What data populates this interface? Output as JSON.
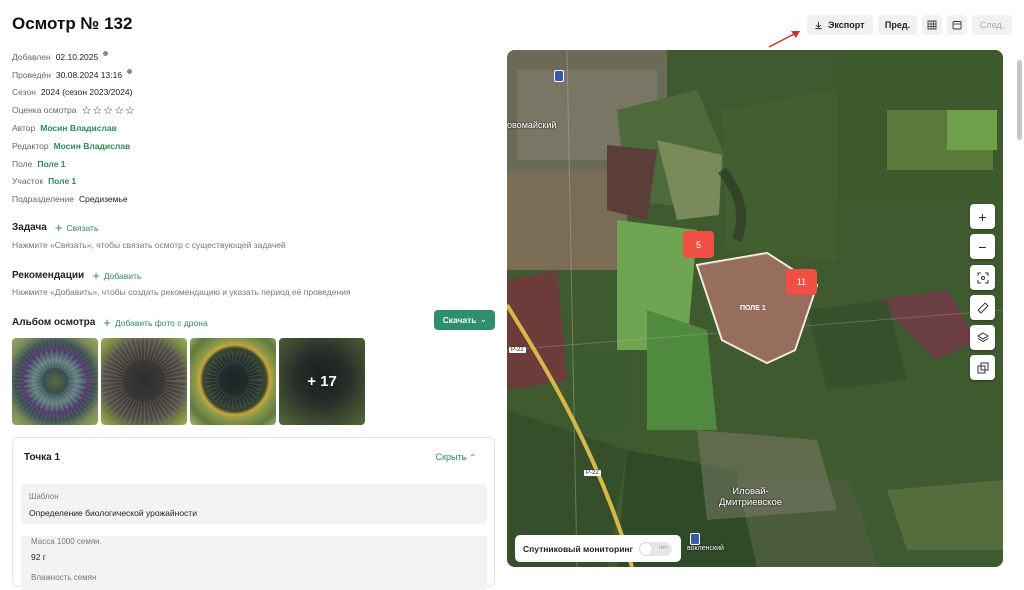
{
  "page": {
    "title": "Осмотр № 132"
  },
  "toolbar": {
    "export": "Экспорт",
    "prev": "Пред.",
    "next": "След."
  },
  "meta": {
    "added_label": "Добавлен",
    "added_value": "02.10.2025",
    "done_label": "Проведён",
    "done_value": "30.08.2024 13:16",
    "season_label": "Сезон",
    "season_value": "2024 (сезон 2023/2024)",
    "rating_label": "Оценка осмотра",
    "rating_stars": "☆☆☆☆☆",
    "author_label": "Автор",
    "author_value": "Мосин Владислав",
    "editor_label": "Редактор",
    "editor_value": "Мосин Владислав",
    "field_label": "Поле",
    "field_value": "Поле 1",
    "plot_label": "Участок",
    "plot_value": "Поле 1",
    "division_label": "Подразделение",
    "division_value": "Средиземье"
  },
  "task": {
    "title": "Задача",
    "action": "Связать",
    "hint": "Нажмите «Связать», чтобы связать осмотр с существующей задачей"
  },
  "recs": {
    "title": "Рекомендации",
    "action": "Добавить",
    "hint": "Нажмите «Добавить», чтобы создать рекомендацию и указать период её проведения"
  },
  "album": {
    "title": "Альбом осмотра",
    "action": "Добавить фото с дрона",
    "download": "Скачать",
    "more": "+ 17"
  },
  "point": {
    "title": "Точка 1",
    "hide": "Скрыть",
    "template_label": "Шаблон",
    "template_value": "Определение биологической урожайности",
    "mass_label": "Масса 1000 семян.",
    "mass_value": "92 г",
    "humidity_label": "Влажность семян"
  },
  "map": {
    "pin1": "5",
    "pin2": "11",
    "field_name": "ПОЛЕ 1",
    "place1": "овомайский",
    "place2": "Иловай-\nДмитриевское",
    "place3": "вокленский",
    "road1": "Р-22",
    "road2": "Р-22",
    "satellite_label": "Спутниковый мониторинг",
    "toggle_text": "Нет",
    "zoom_in": "+",
    "zoom_out": "−"
  },
  "colors": {
    "accent": "#2e8b57",
    "download_bg": "#2f8f6b",
    "pin": "#f05043"
  }
}
